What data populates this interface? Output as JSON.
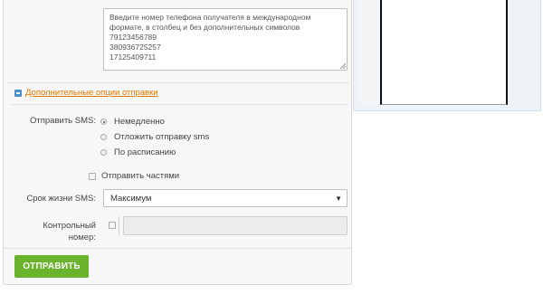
{
  "recipients": {
    "placeholder": "Введите номер телефона получателя в международном формате, в столбец и без дополнительных символов",
    "numbers": [
      "79123456789",
      "380936725257",
      "17125409711"
    ]
  },
  "more_options_link": "Дополнительные опции отправки",
  "send_sms": {
    "label": "Отправить SMS:",
    "options": [
      {
        "label": "Немедленно",
        "checked": true
      },
      {
        "label": "Отложить отправку sms",
        "checked": false
      },
      {
        "label": "По расписанию",
        "checked": false
      }
    ]
  },
  "send_parts_label": "Отправить частями",
  "lifetime": {
    "label": "Срок жизни SMS:",
    "value": "Максимум"
  },
  "control_number": {
    "label_line1": "Контрольный",
    "label_line2": "номер:"
  },
  "send_button": "ОТПРАВИТЬ",
  "icons": {
    "options": "settings-icon",
    "select_arrow": "triangle-down-icon"
  }
}
